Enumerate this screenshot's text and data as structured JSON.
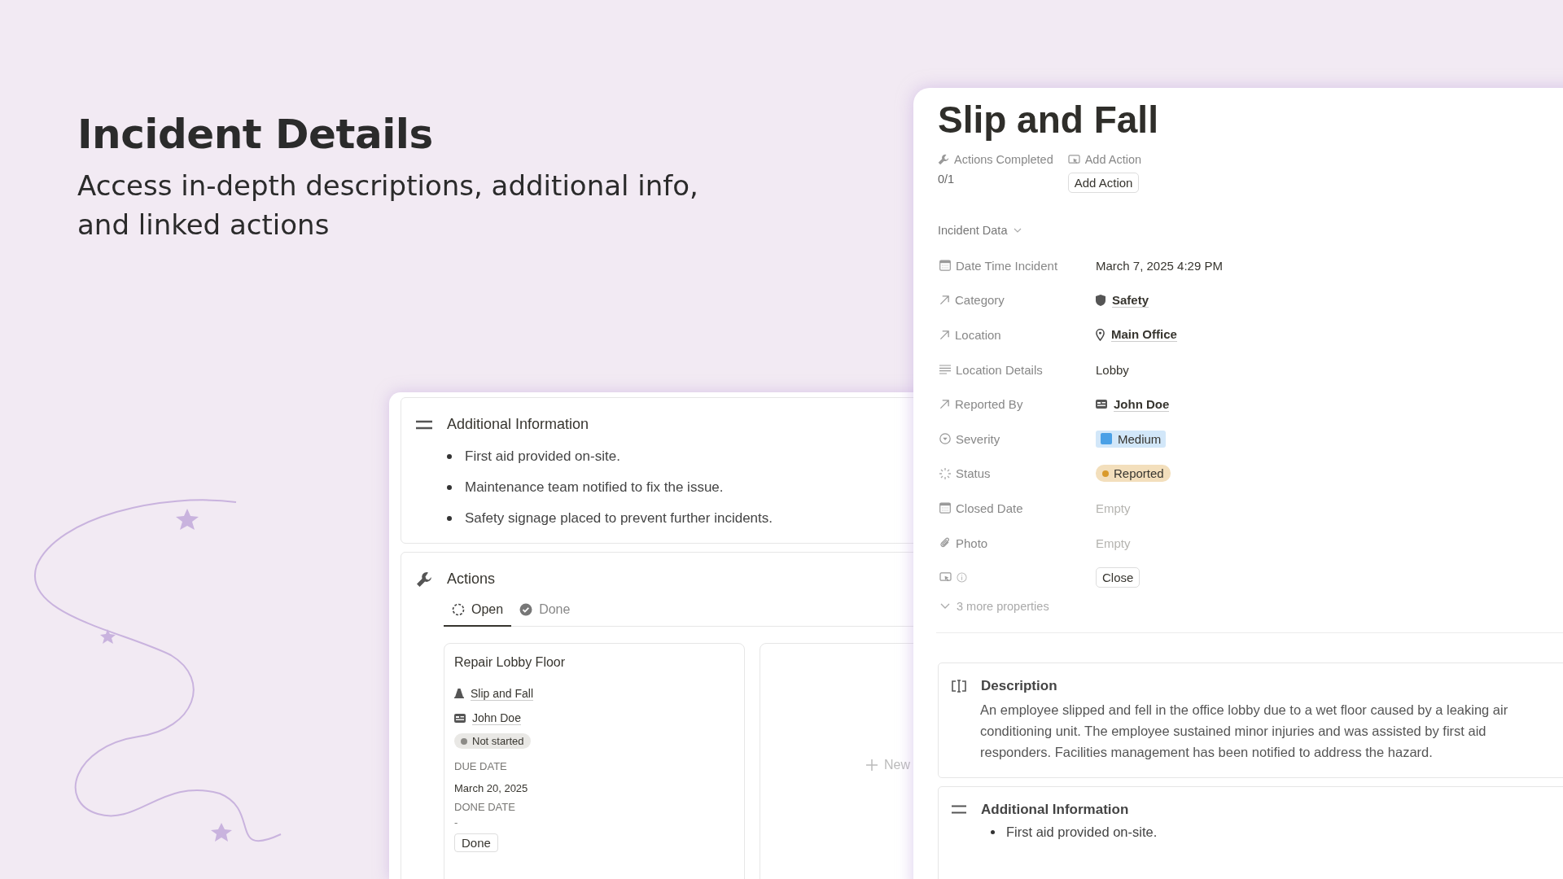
{
  "hero": {
    "title": "Incident Details",
    "subtitle": "Access in-depth descriptions, additional info, and linked actions"
  },
  "left_panel": {
    "additional_info": {
      "heading": "Additional Information",
      "items": [
        "First aid provided on-site.",
        "Maintenance team notified to fix the issue.",
        "Safety signage placed to prevent further incidents."
      ]
    },
    "actions": {
      "heading": "Actions",
      "tabs": [
        {
          "label": "Open",
          "selected": true,
          "kind": "open"
        },
        {
          "label": "Done",
          "selected": false,
          "kind": "done"
        }
      ],
      "cards": [
        {
          "title": "Repair Lobby Floor",
          "incident": "Slip and Fall",
          "person": "John Doe",
          "status": "Not started",
          "due_label": "DUE DATE",
          "due": "March 20, 2025",
          "done_label": "DONE DATE",
          "done": "-",
          "button": "Done"
        }
      ],
      "new_label": "New"
    }
  },
  "right_panel": {
    "title": "Slip and Fall",
    "summary": [
      {
        "kind": "rollup",
        "label": "Actions Completed",
        "value": "0/1"
      },
      {
        "kind": "button",
        "label": "Add Action",
        "value": "Add Action"
      }
    ],
    "section": "Incident Data",
    "properties": [
      {
        "kind": "date",
        "label": "Date Time Incident",
        "value": "March 7, 2025 4:29 PM",
        "empty": false
      },
      {
        "kind": "relation",
        "label": "Category",
        "value": "Safety"
      },
      {
        "kind": "relation",
        "label": "Location",
        "value": "Main Office"
      },
      {
        "kind": "text",
        "label": "Location Details",
        "value": "Lobby",
        "empty": false
      },
      {
        "kind": "relation",
        "label": "Reported By",
        "value": "John Doe"
      },
      {
        "kind": "select",
        "label": "Severity",
        "value": "Medium",
        "color": "#4aa0e6"
      },
      {
        "kind": "status",
        "label": "Status",
        "value": "Reported",
        "color": "#d99a2b"
      },
      {
        "kind": "date",
        "label": "Closed Date",
        "value": "Empty",
        "empty": true
      },
      {
        "kind": "files",
        "label": "Photo",
        "value": "Empty",
        "empty": true
      },
      {
        "kind": "button",
        "value": "Close"
      }
    ],
    "more": "3 more properties",
    "description": {
      "heading": "Description",
      "text": "An employee slipped and fell in the office lobby due to a wet floor caused by a leaking air conditioning unit. The employee sustained minor injuries and was assisted by first aid responders. Facilities management has been notified to address the hazard."
    },
    "additional_info": {
      "heading": "Additional Information",
      "items": [
        "First aid provided on-site."
      ]
    }
  }
}
